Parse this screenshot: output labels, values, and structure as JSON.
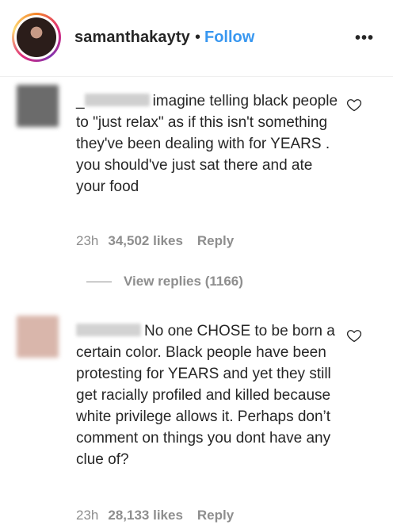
{
  "header": {
    "username": "samanthakayty",
    "separator": "•",
    "follow_label": "Follow",
    "more_icon": "more-horizontal-icon",
    "more_glyph": "•••"
  },
  "comments": [
    {
      "text_prefix": "_",
      "text": "imagine telling black people to \"just relax\" as if this isn't something they've been dealing with for YEARS . you should've just sat there and ate your food",
      "time": "23h",
      "likes": "34,502 likes",
      "reply_label": "Reply",
      "view_replies": "View replies (1166)"
    },
    {
      "text": "No one CHOSE to be born a certain color. Black people have been protesting for YEARS and yet they still get racially profiled and killed because white privilege allows it. Perhaps don’t comment on things you dont have any clue of?",
      "time": "23h",
      "likes": "28,133 likes",
      "reply_label": "Reply"
    }
  ],
  "colors": {
    "link_blue": "#3897f0",
    "text_primary": "#262626",
    "text_secondary": "#8e8e8e"
  }
}
